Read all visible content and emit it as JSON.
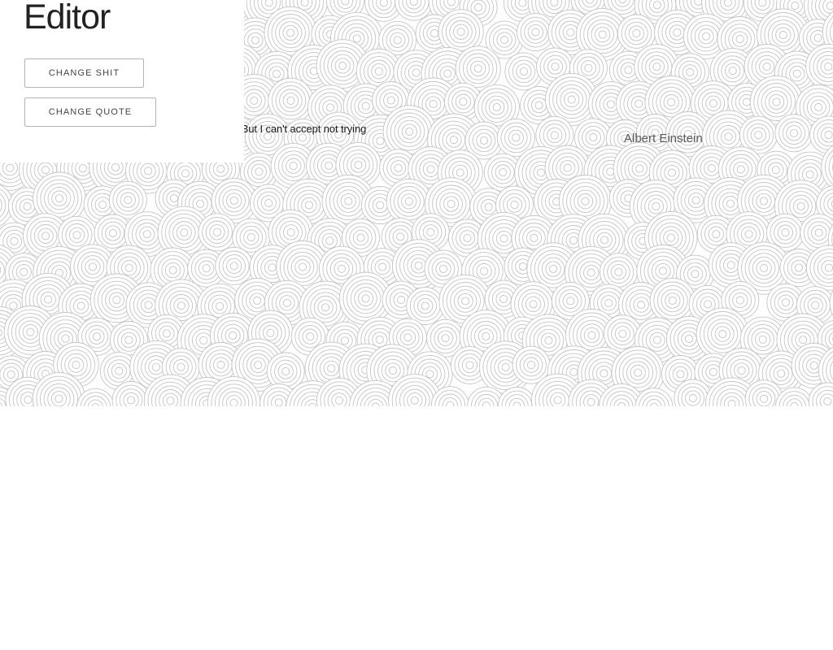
{
  "editor": {
    "title": "Editor",
    "change_shit_label": "CHANGE SHIT",
    "change_quote_label": "CHANGE QUOTE"
  },
  "quote": {
    "text": "I can accept failure, everyone fails at something. But I can't accept not trying",
    "author": "Albert Einstein"
  },
  "colors": {
    "pattern_stroke": "#c4c4c4",
    "title": "#222222",
    "author": "#5a5a5a"
  }
}
